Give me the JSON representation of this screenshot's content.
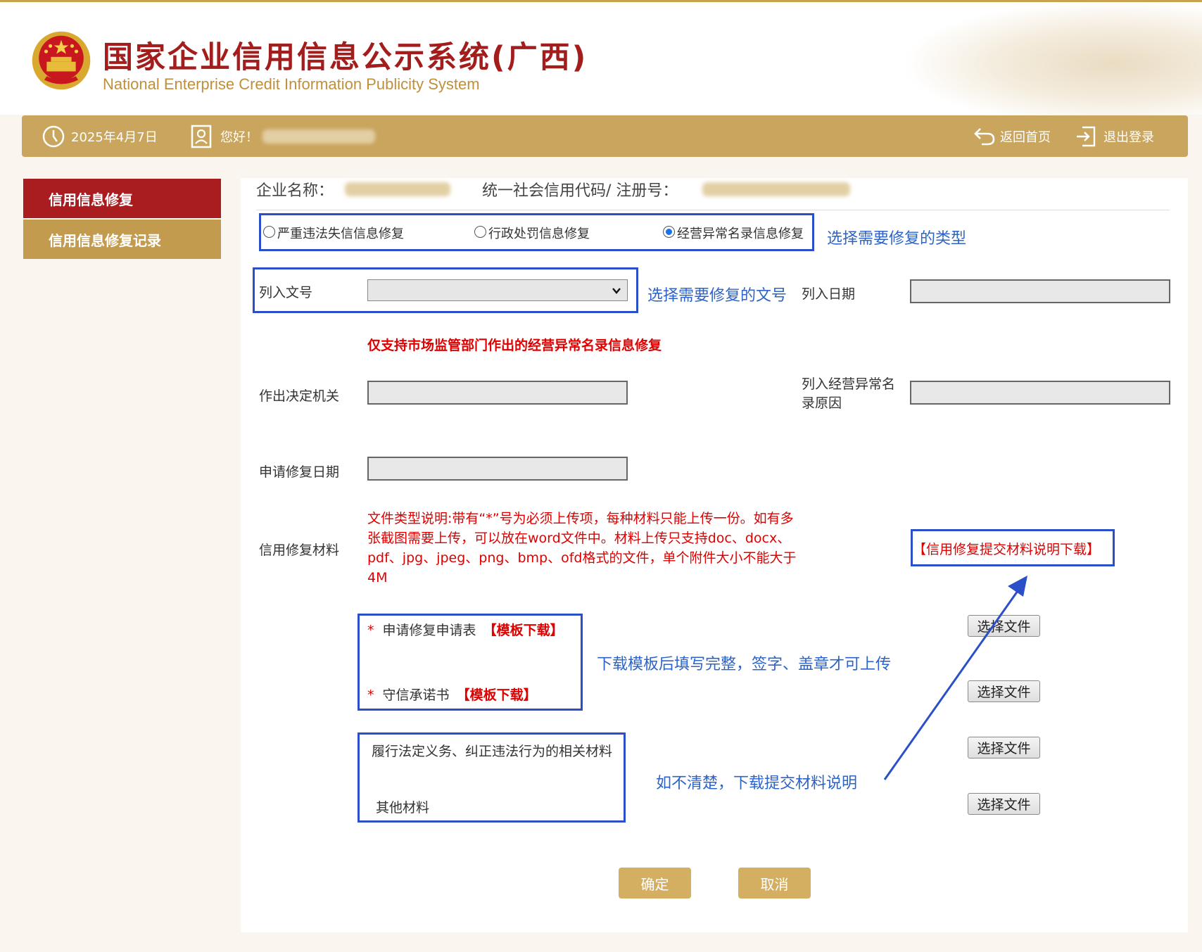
{
  "header": {
    "title": "国家企业信用信息公示系统(广西)",
    "subtitle": "National Enterprise Credit Information Publicity System"
  },
  "topbar": {
    "date": "2025年4月7日",
    "greeting": "您好！",
    "home_label": "返回首页",
    "logout_label": "退出登录"
  },
  "sidebar": {
    "items": [
      {
        "label": "信用信息修复",
        "active": true
      },
      {
        "label": "信用信息修复记录",
        "active": false
      }
    ]
  },
  "form": {
    "company_label": "企业名称：",
    "code_label": "统一社会信用代码/ 注册号：",
    "repair_types": [
      {
        "label": "严重违法失信信息修复",
        "selected": false
      },
      {
        "label": "行政处罚信息修复",
        "selected": false
      },
      {
        "label": "经营异常名录信息修复",
        "selected": true
      }
    ],
    "doc_no_label": "列入文号",
    "doc_no_value": "",
    "date_label": "列入日期",
    "notice": "仅支持市场监管部门作出的经营异常名录信息修复",
    "authority_label": "作出决定机关",
    "reason_label": "列入经营异常名录原因",
    "apply_date_label": "申请修复日期",
    "materials_label": "信用修复材料",
    "file_note": "文件类型说明:带有“*”号为必须上传项，每种材料只能上传一份。如有多张截图需要上传，可以放在word文件中。材料上传只支持doc、docx、pdf、jpg、jpeg、png、bmp、ofd格式的文件，单个附件大小不能大于4M",
    "download_link": "【信用修复提交材料说明下载】",
    "materials": [
      {
        "required": true,
        "label": "申请修复申请表",
        "template": "【模板下载】",
        "button": "选择文件"
      },
      {
        "required": true,
        "label": "守信承诺书",
        "template": "【模板下载】",
        "button": "选择文件"
      },
      {
        "required": false,
        "label": "履行法定义务、纠正违法行为的相关材料",
        "button": "选择文件"
      },
      {
        "required": false,
        "label": "其他材料",
        "button": "选择文件"
      }
    ],
    "required_mark": "*",
    "confirm_label": "确定",
    "cancel_label": "取消"
  },
  "annotations": {
    "select_type": "选择需要修复的类型",
    "select_doc": "选择需要修复的文号",
    "fill_template": "下载模板后填写完整，签字、盖章才可上传",
    "download_hint": "如不清楚，下载提交材料说明"
  },
  "colors": {
    "brand_gold": "#c9a55d",
    "brand_red": "#a91d21",
    "annotation_blue": "#2b4fc8",
    "warning_red": "#e00000"
  }
}
